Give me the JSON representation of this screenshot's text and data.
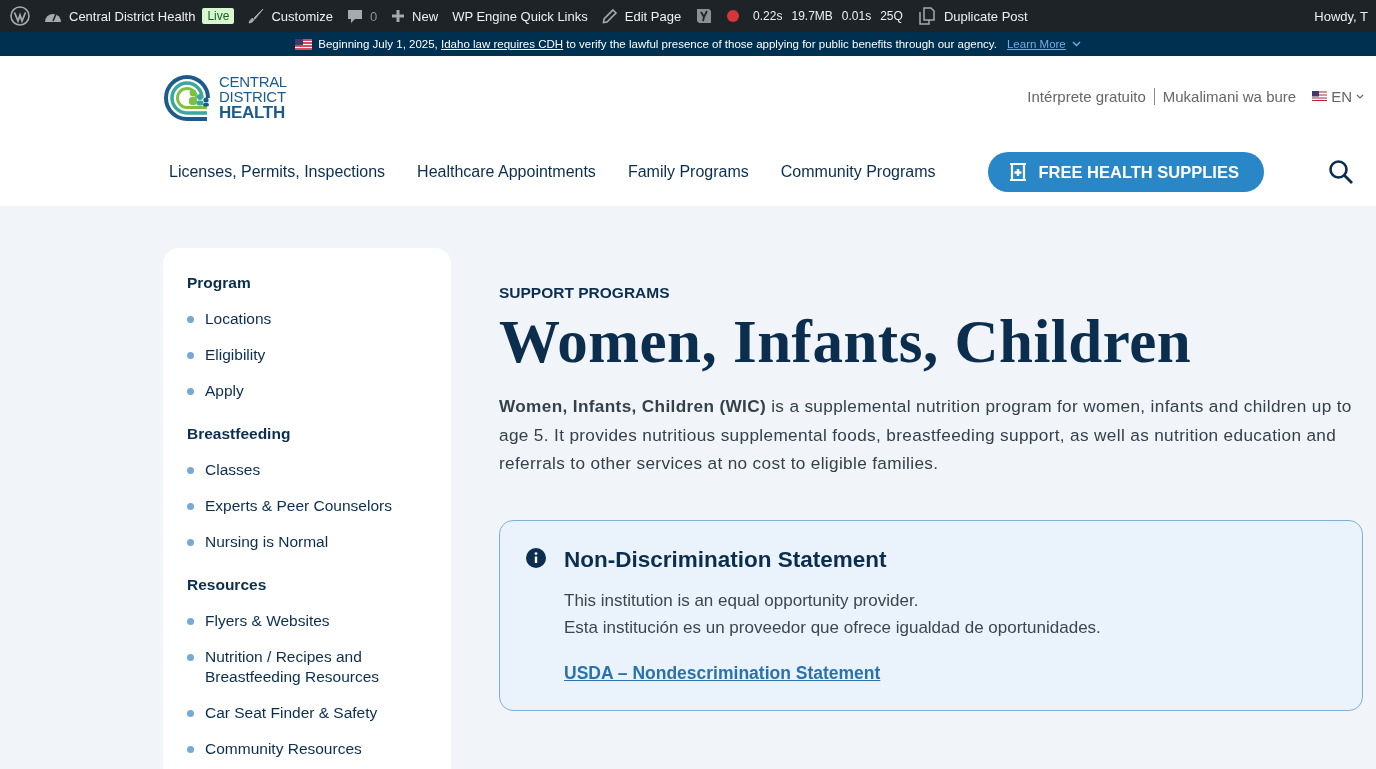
{
  "admin_bar": {
    "site_name": "Central District Health",
    "live_badge": "Live",
    "customize": "Customize",
    "comments_count": "0",
    "new": "New",
    "quick_links": "WP Engine Quick Links",
    "edit_page": "Edit Page",
    "stats": [
      "0.22s",
      "19.7MB",
      "0.01s",
      "25Q"
    ],
    "duplicate_post": "Duplicate Post",
    "howdy": "Howdy, T"
  },
  "notice": {
    "before": "Beginning July 1, 2025, ",
    "link": "Idaho law requires CDH",
    "after": " to verify the lawful presence of those applying for public benefits through our agency.",
    "learn_more": "Learn More"
  },
  "header": {
    "logo_lines": [
      "CENTRAL",
      "DISTRICT",
      "HEALTH"
    ],
    "interpreter_links": [
      "Intérprete gratuito",
      "Mukalimani wa bure"
    ],
    "language": "EN",
    "nav": [
      "Licenses, Permits, Inspections",
      "Healthcare Appointments",
      "Family Programs",
      "Community Programs"
    ],
    "cta": "FREE HEALTH SUPPLIES"
  },
  "sidebar": {
    "sections": [
      {
        "heading": "Program",
        "items": [
          "Locations",
          "Eligibility",
          "Apply"
        ]
      },
      {
        "heading": "Breastfeeding",
        "items": [
          "Classes",
          "Experts & Peer Counselors",
          "Nursing is Normal"
        ]
      },
      {
        "heading": "Resources",
        "items": [
          "Flyers & Websites",
          "Nutrition / Recipes and Breastfeeding Resources",
          "Car Seat Finder & Safety",
          "Community Resources"
        ]
      }
    ]
  },
  "content": {
    "eyebrow": "SUPPORT PROGRAMS",
    "title": "Women, Infants, Children",
    "intro": "**Women, Infants, Children (WIC)** is a supplemental nutrition program for women, infants and children up to age 5. It provides nutritious supplemental foods, breastfeeding support, as well as nutrition education and referrals to other services at no cost to eligible families.",
    "statement": {
      "title": "Non-Discrimination Statement",
      "lines": [
        "This institution is an equal opportunity provider.",
        "Esta institución es un proveedor que ofrece igualdad de oportunidades."
      ],
      "link": "USDA – Nondescrimination Statement"
    }
  }
}
